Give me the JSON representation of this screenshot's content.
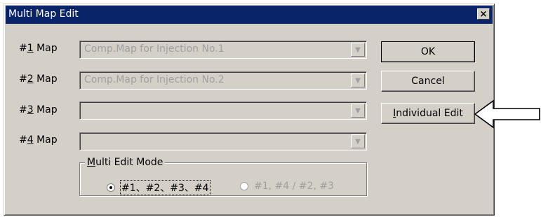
{
  "window": {
    "title": "Multi Map Edit",
    "close_glyph": "×"
  },
  "maps": [
    {
      "prefix": "#",
      "number": "1",
      "suffix": " Map",
      "value": "Comp.Map for Injection No.1"
    },
    {
      "prefix": "#",
      "number": "2",
      "suffix": " Map",
      "value": "Comp.Map for Injection No.2"
    },
    {
      "prefix": "#",
      "number": "3",
      "suffix": " Map",
      "value": ""
    },
    {
      "prefix": "#",
      "number": "4",
      "suffix": " Map",
      "value": ""
    }
  ],
  "combo_arrow_glyph": "▼",
  "buttons": {
    "ok": "OK",
    "cancel": "Cancel",
    "individual_first": "I",
    "individual_rest": "ndividual Edit"
  },
  "multi_edit": {
    "title_first": "M",
    "title_rest": "ulti Edit Mode",
    "options": [
      {
        "label": "#1、#2、#3、#4",
        "selected": true,
        "enabled": true
      },
      {
        "label": "#1, #4 / #2, #3",
        "selected": false,
        "enabled": false
      }
    ]
  },
  "annotation": {
    "icon": "left-pointing-outline-arrow-icon",
    "color": "#000000"
  }
}
